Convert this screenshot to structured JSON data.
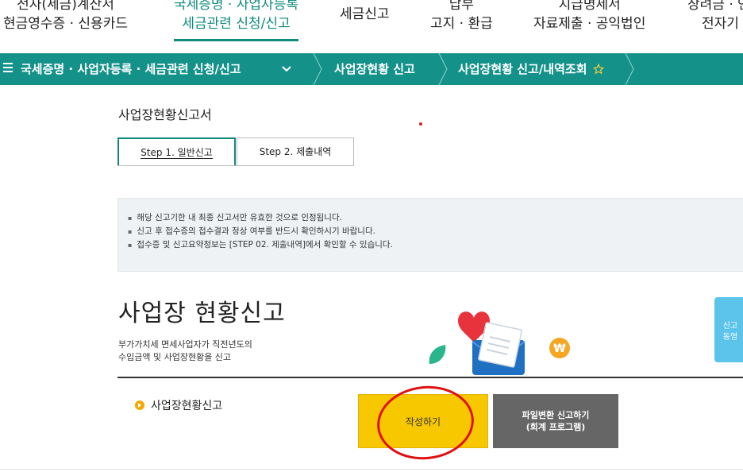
{
  "topnav": {
    "items": [
      {
        "line1": "전자(세금)계산서",
        "line2": "현금영수증 · 신용카드"
      },
      {
        "line1": "국세증명 · 사업자등록",
        "line2": "세금관련 신청/신고",
        "active": true
      },
      {
        "line1": "세금신고",
        "line2": ""
      },
      {
        "line1": "납부",
        "line2": "고지 · 환급"
      },
      {
        "line1": "지급명세서",
        "line2": "자료제출 · 공익법인"
      },
      {
        "line1": "장려금 · 연",
        "line2": "전자기"
      }
    ]
  },
  "breadcrumb": {
    "items": [
      "국세증명 · 사업자등록 · 세금관련 신청/신고",
      "사업장현황 신고",
      "사업장현황 신고/내역조회"
    ],
    "star_icon": "star-outline-icon",
    "dropdown_icon": "chevron-down-icon",
    "menu_icon": "hamburger-icon"
  },
  "page": {
    "title": "사업장현황신고서",
    "tabs": [
      "Step 1. 일반신고",
      "Step 2. 제출내역"
    ],
    "notice": [
      "해당 신고기한 내 최종 신고서만 유효한 것으로 인정됩니다.",
      "신고 후 접수증의 접수결과 정상 여부를 반드시 확인하시기 바랍니다.",
      "접수증 및 신고요약정보는 [STEP 02. 제출내역]에서 확인할 수 있습니다."
    ],
    "big_title": "사업장 현황신고",
    "desc_line1": "부가가치세 면세사업자가 직전년도의",
    "desc_line2": "수입금액 및 사업장현황을 신고",
    "side_button": {
      "line1": "신고",
      "line2": "동영"
    },
    "section_label": "사업장현황신고",
    "write_button": "작성하기",
    "file_button_line1": "파일변환 신고하기",
    "file_button_line2": "(회계 프로그램)"
  },
  "colors": {
    "accent": "#0f8a7e",
    "crumb_bar": "#14928a",
    "write_button": "#f7c700",
    "file_button": "#666666",
    "annotation_circle": "#e01010"
  }
}
